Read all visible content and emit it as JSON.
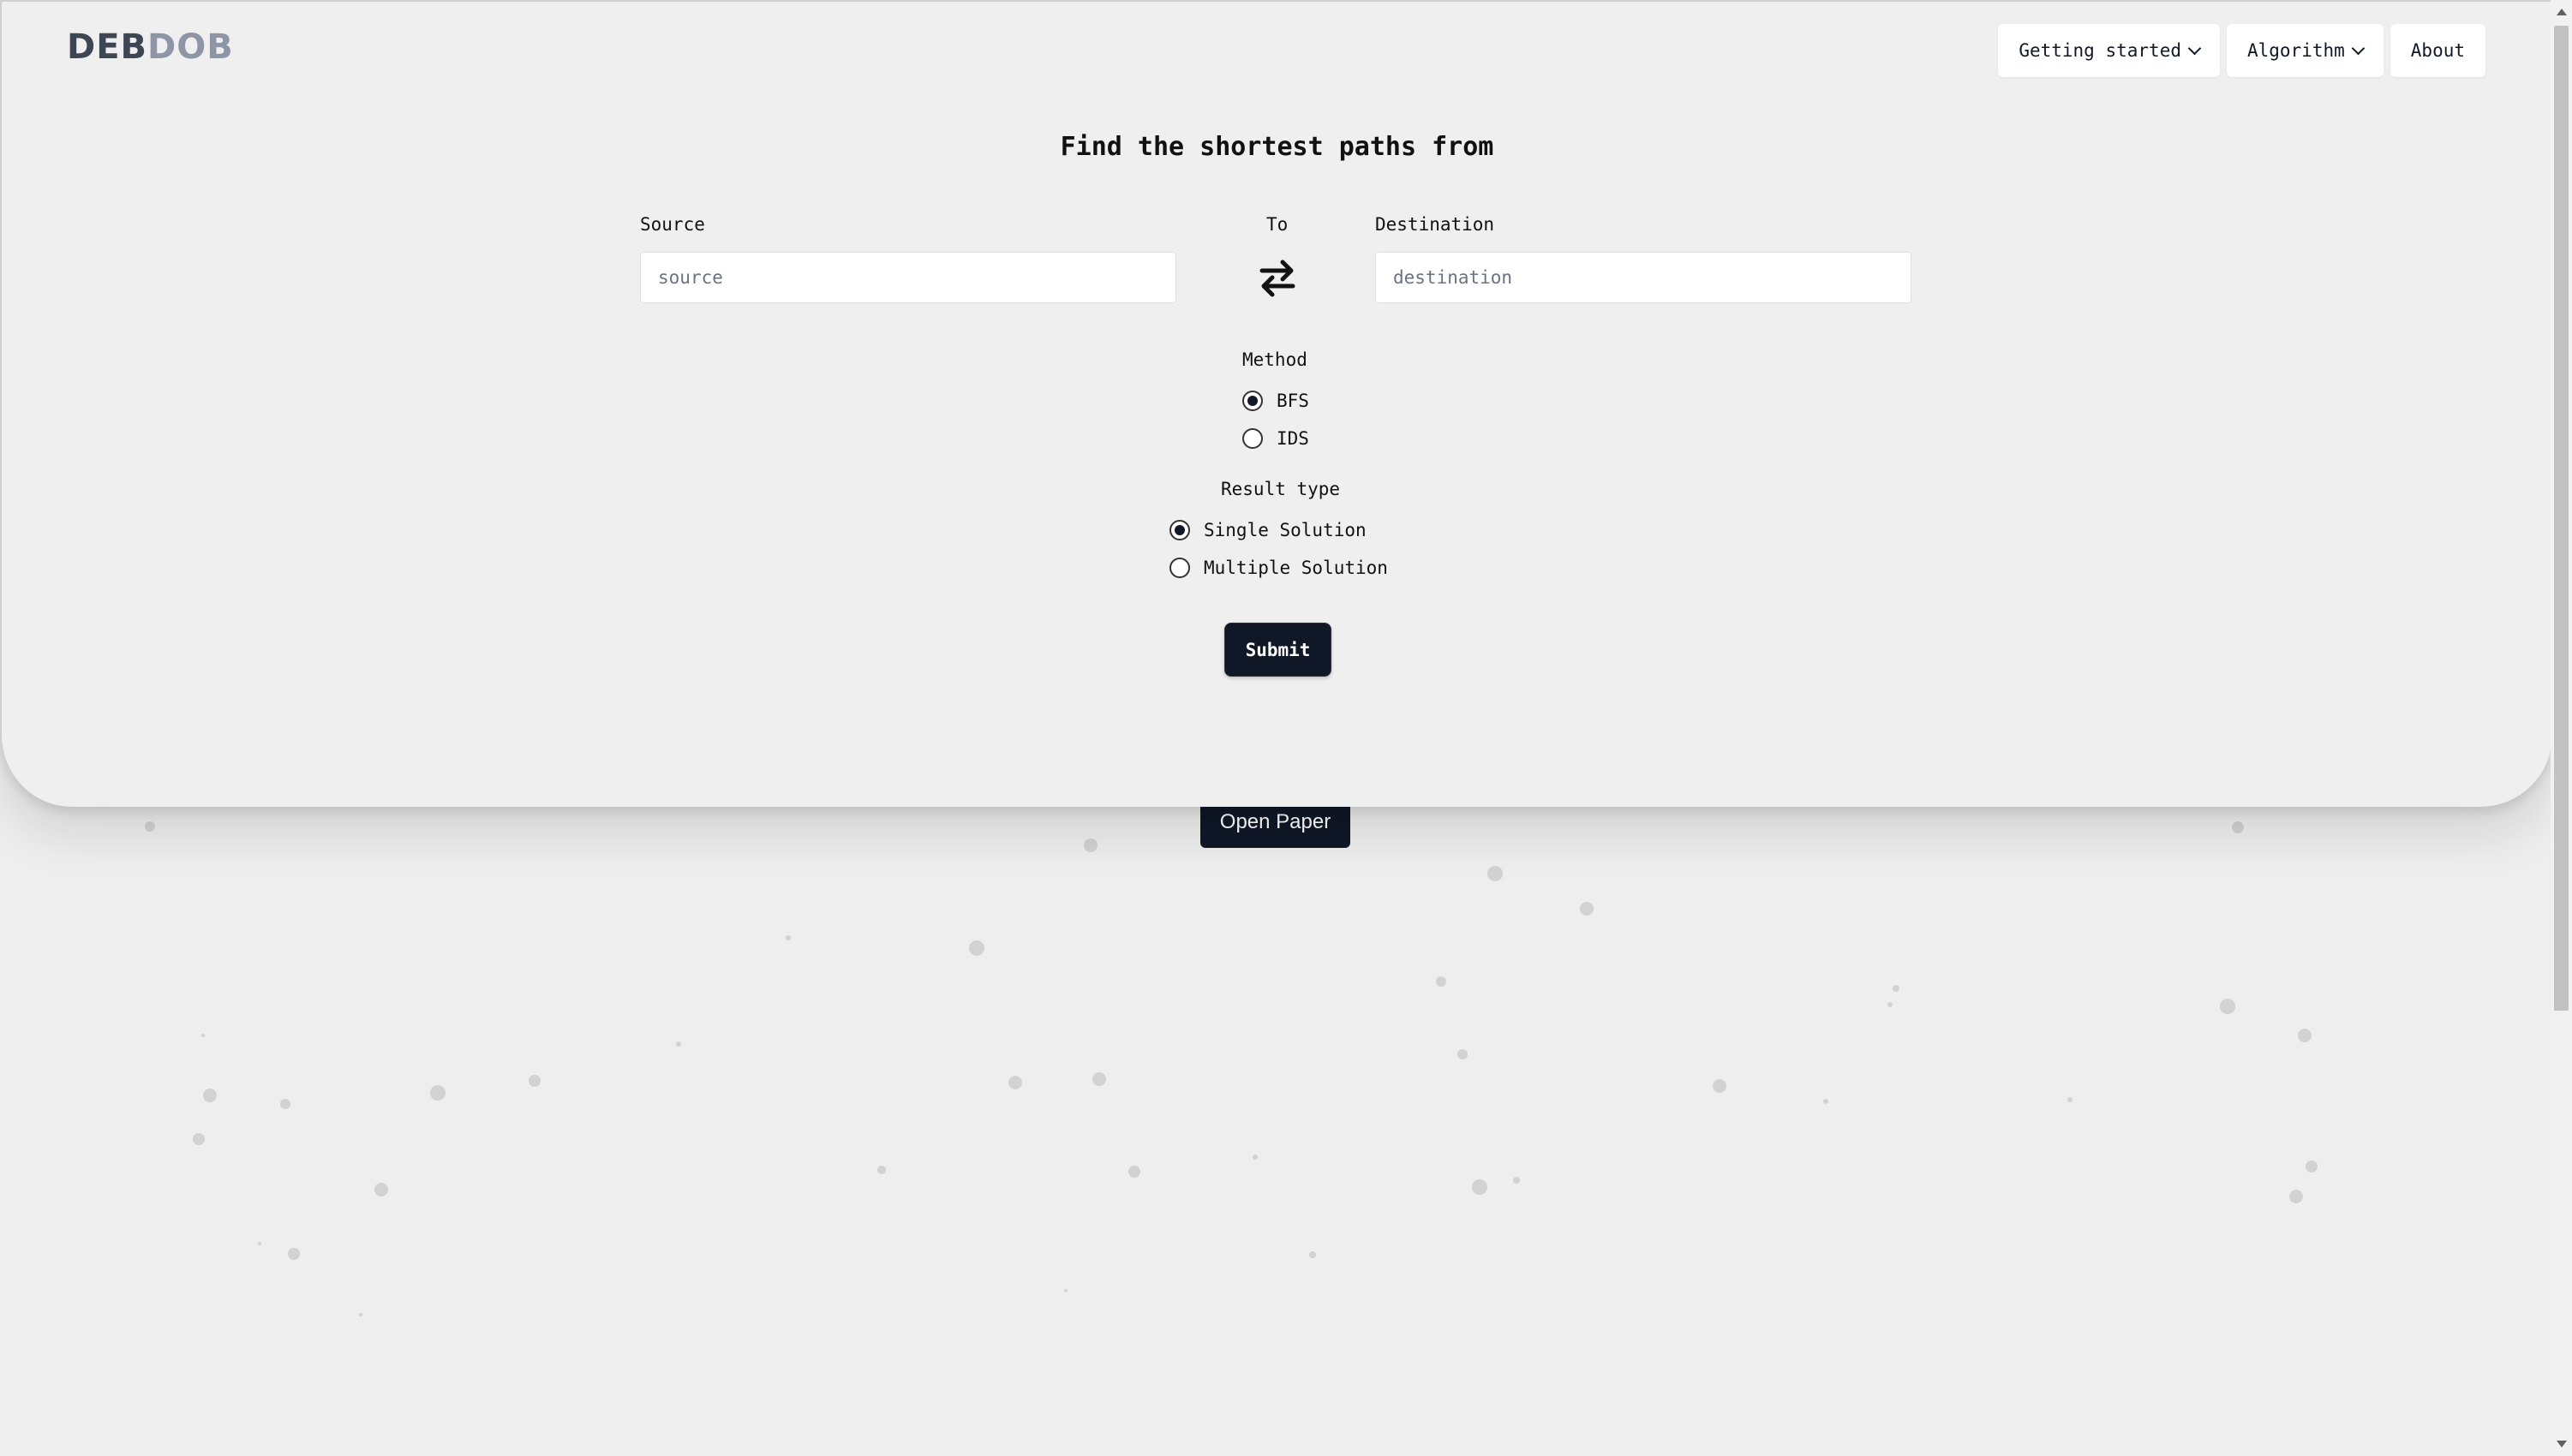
{
  "brand": {
    "part1": "DEB",
    "part2": "DOB",
    "colors": {
      "part1": "#3f4653",
      "part2": "#8d95a6"
    }
  },
  "nav": {
    "getting_started": "Getting started",
    "algorithm": "Algorithm",
    "about": "About"
  },
  "form": {
    "title": "Find the shortest paths from",
    "source_label": "Source",
    "source_placeholder": "source",
    "to_label": "To",
    "destination_label": "Destination",
    "destination_placeholder": "destination",
    "swap_icon": "swap-arrows-icon",
    "method": {
      "label": "Method",
      "selected": "BFS",
      "options": [
        "BFS",
        "IDS"
      ]
    },
    "result_type": {
      "label": "Result type",
      "selected": "Single Solution",
      "options": [
        "Single Solution",
        "Multiple Solution"
      ]
    },
    "submit_label": "Submit"
  },
  "open_paper_label": "Open Paper",
  "colors": {
    "page_background": "#eeeeee",
    "panel_background": "#efefef",
    "button_dark": "#101828",
    "dot": "#d2d2d2"
  }
}
